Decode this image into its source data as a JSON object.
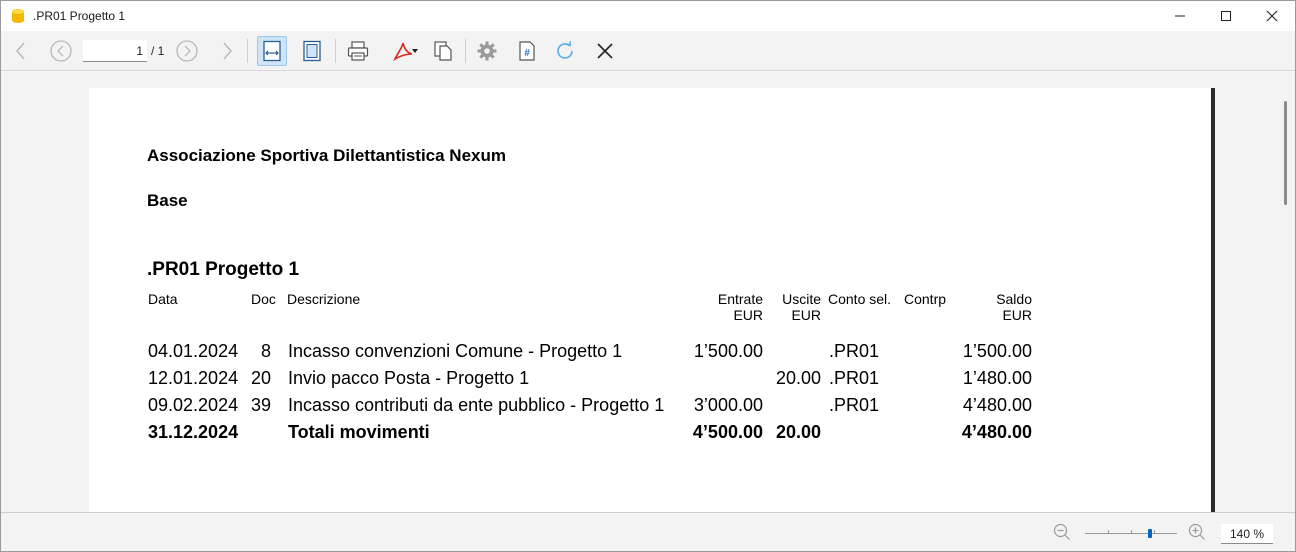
{
  "window": {
    "title": ".PR01 Progetto 1",
    "minimize": "—",
    "maximize": "☐",
    "close": "✕"
  },
  "toolbar": {
    "page_current": "1",
    "page_total": "/ 1",
    "icons": [
      "back-icon",
      "first-page-icon",
      "prev-page-icon",
      "next-page-icon",
      "fit-width-icon",
      "fit-page-icon",
      "print-icon",
      "pdf-icon",
      "copy-icon",
      "settings-icon",
      "page-number-icon",
      "refresh-icon",
      "close-icon"
    ]
  },
  "report": {
    "company": "Associazione Sportiva Dilettantistica Nexum",
    "subtitle": "Base",
    "title": ".PR01 Progetto 1",
    "headers": {
      "data": "Data",
      "doc": "Doc",
      "descrizione": "Descrizione",
      "entrate": "Entrate",
      "entrate_unit": "EUR",
      "uscite": "Uscite",
      "uscite_unit": "EUR",
      "conto_sel": "Conto sel.",
      "contrp": "Contrp",
      "saldo": "Saldo",
      "saldo_unit": "EUR"
    },
    "rows": [
      {
        "data": "04.01.2024",
        "doc": "8",
        "descrizione": "Incasso convenzioni Comune - Progetto 1",
        "entrate": "1’500.00",
        "uscite": "",
        "conto": ".PR01",
        "contrp": "",
        "saldo": "1’500.00"
      },
      {
        "data": "12.01.2024",
        "doc": "20",
        "descrizione": "Invio pacco Posta - Progetto 1",
        "entrate": "",
        "uscite": "20.00",
        "conto": ".PR01",
        "contrp": "",
        "saldo": "1’480.00"
      },
      {
        "data": "09.02.2024",
        "doc": "39",
        "descrizione": "Incasso contributi da ente pubblico - Progetto 1",
        "entrate": "3’000.00",
        "uscite": "",
        "conto": ".PR01",
        "contrp": "",
        "saldo": "4’480.00"
      }
    ],
    "total": {
      "data": "31.12.2024",
      "descrizione": "Totali movimenti",
      "entrate": "4’500.00",
      "uscite": "20.00",
      "saldo": "4’480.00"
    }
  },
  "statusbar": {
    "zoom": "140 %",
    "zoom_level_pct": 72
  },
  "colors": {
    "accent": "#0067c0",
    "pdf_red": "#d9261c",
    "refresh_blue": "#55aee6"
  }
}
